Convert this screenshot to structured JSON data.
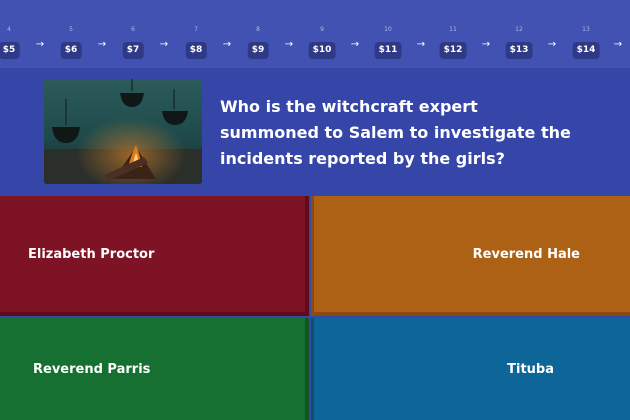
{
  "ladder": {
    "steps": [
      {
        "num": "4",
        "amount": "$5"
      },
      {
        "num": "5",
        "amount": "$6"
      },
      {
        "num": "6",
        "amount": "$7"
      },
      {
        "num": "7",
        "amount": "$8"
      },
      {
        "num": "8",
        "amount": "$9"
      },
      {
        "num": "9",
        "amount": "$10"
      },
      {
        "num": "10",
        "amount": "$11"
      },
      {
        "num": "11",
        "amount": "$12"
      },
      {
        "num": "12",
        "amount": "$13"
      },
      {
        "num": "13",
        "amount": "$14"
      }
    ],
    "arrow_icon": "arrow-right-icon"
  },
  "question": {
    "text": "Who is the witchcraft expert summoned to Salem to investigate the incidents reported by the girls?",
    "image_icon": "campfire-cauldron-image"
  },
  "answers": [
    {
      "label": "Elizabeth Proctor",
      "color": "#7e1325"
    },
    {
      "label": "Reverend Hale",
      "color": "#ad6115"
    },
    {
      "label": "Reverend Parris",
      "color": "#167031"
    },
    {
      "label": "Tituba",
      "color": "#0d6598"
    }
  ]
}
